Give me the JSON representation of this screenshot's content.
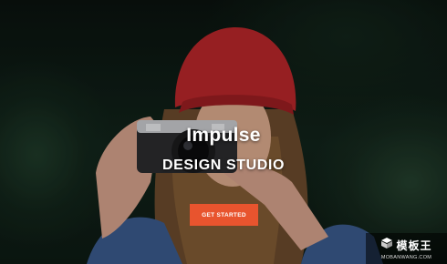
{
  "hero": {
    "title": "Impulse",
    "subtitle": "DESIGN STUDIO",
    "cta_label": "GET STARTED"
  },
  "watermark": {
    "main": "模板王",
    "sub": "MOBANWANG.COM",
    "icon": "cube-logo-icon"
  },
  "colors": {
    "accent": "#e8542e",
    "hat": "#b8262a",
    "foliage": "#1f3a29"
  }
}
